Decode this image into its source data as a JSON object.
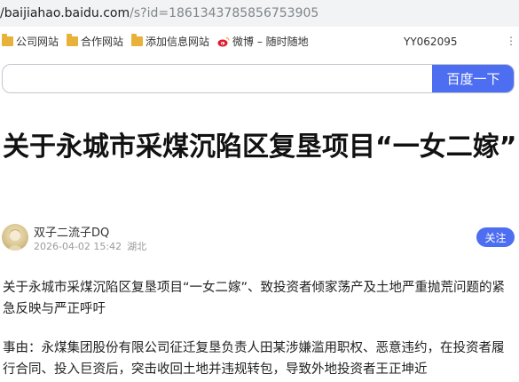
{
  "browser": {
    "url_host": "/baijiahao.baidu.com",
    "url_path": "/s?id=1861343785856753905"
  },
  "bookmarks": [
    {
      "label": "公司网站",
      "icon": "folder-icon"
    },
    {
      "label": "合作网站",
      "icon": "folder-icon"
    },
    {
      "label": "添加信息网站",
      "icon": "folder-icon"
    },
    {
      "label": "微博 – 随时随地",
      "icon": "weibo-icon"
    }
  ],
  "user_code": "YY062095",
  "search": {
    "value": "",
    "button_label": "百度一下"
  },
  "article": {
    "title": "关于永城市采煤沉陷区复垦项目“一女二嫁”",
    "author": "双子二流子DQ",
    "date": "2026-04-02 15:42",
    "location": "湖北",
    "follow_label": "关注",
    "paragraphs": [
      "关于永城市采煤沉陷区复垦项目“一女二嫁”、致投资者倾家荡产及土地严重抛荒问题的紧急反映与严正呼吁",
      "事由：永煤集团股份有限公司征迁复垦负责人田某涉嫌滥用职权、恶意违约，在投资者履行合同、投入巨资后，突击收回土地并违规转包，导致外地投资者王正坤近"
    ]
  }
}
